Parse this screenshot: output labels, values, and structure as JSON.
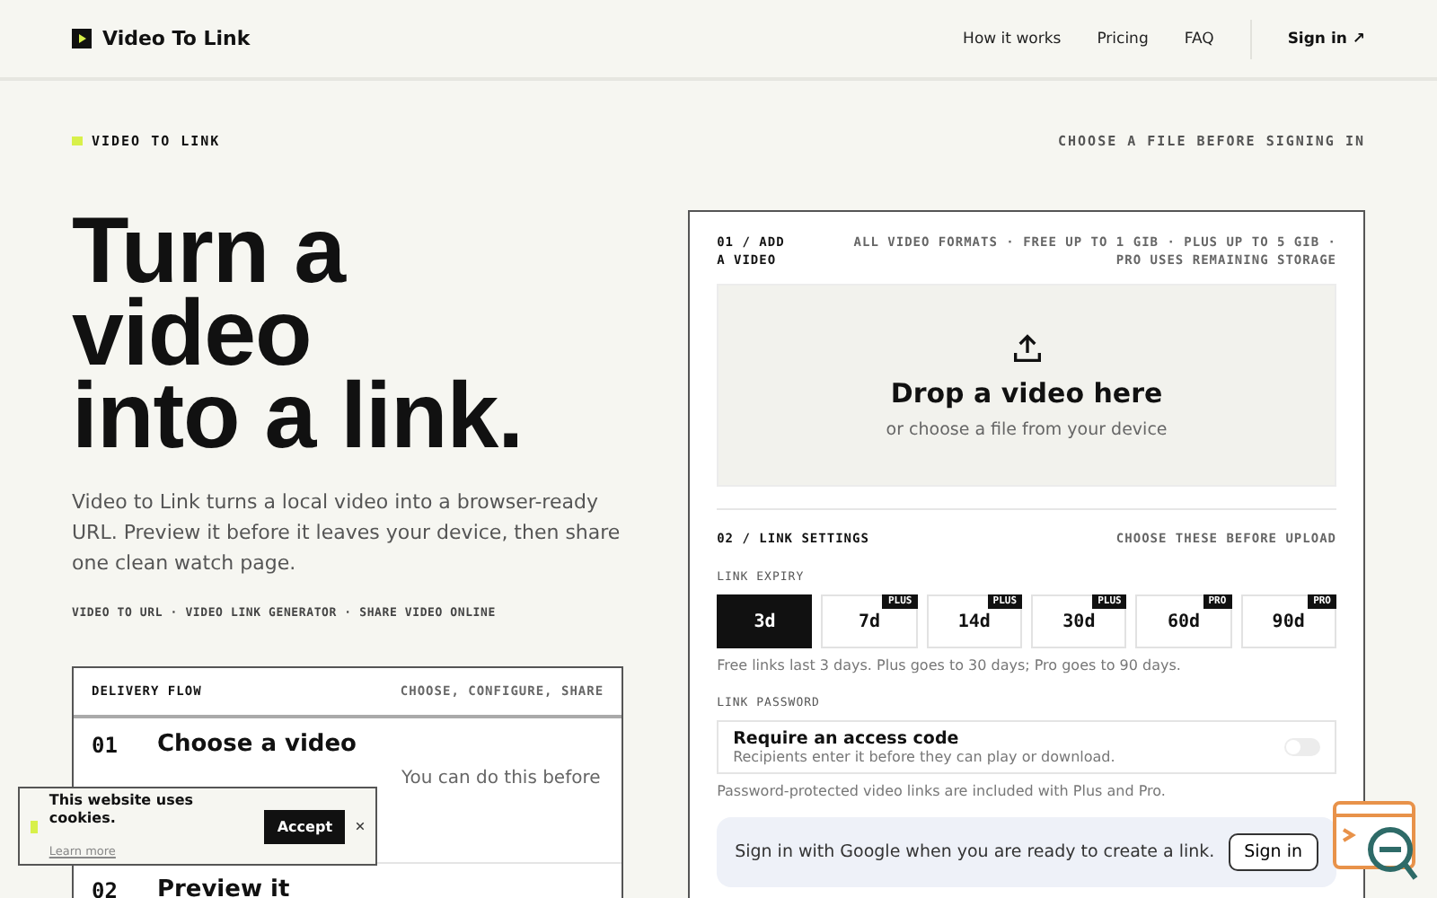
{
  "header": {
    "brand": "Video To Link",
    "nav": [
      "How it works",
      "Pricing",
      "FAQ"
    ],
    "sign_in": "Sign in ↗"
  },
  "eyebrow": {
    "label": "VIDEO TO LINK",
    "note": "CHOOSE A FILE BEFORE SIGNING IN"
  },
  "hero": {
    "headline_lines": [
      "Turn a",
      "video",
      "into a link."
    ],
    "intro": "Video to Link turns a local video into a browser-ready URL. Preview it before it leaves your device, then share one clean watch page.",
    "keywords": "VIDEO TO URL · VIDEO LINK GENERATOR · SHARE VIDEO ONLINE"
  },
  "flow": {
    "title": "DELIVERY FLOW",
    "subtitle": "CHOOSE, CONFIGURE, SHARE",
    "steps": [
      {
        "number": "01",
        "title": "Choose a video",
        "description": "You can do this before"
      },
      {
        "number": "02",
        "title": "Preview it"
      }
    ]
  },
  "upload": {
    "step": "01 / ADD A VIDEO",
    "limits": "ALL VIDEO FORMATS · FREE UP TO 1 GIB · PLUS UP TO 5 GIB · PRO USES REMAINING STORAGE",
    "drop_title": "Drop a video here",
    "drop_hint": "or choose a file from your device"
  },
  "settings": {
    "step": "02 / LINK SETTINGS",
    "note": "CHOOSE THESE BEFORE UPLOAD",
    "expiry_label": "LINK EXPIRY",
    "expiry_options": [
      {
        "label": "3d",
        "selected": true
      },
      {
        "label": "7d",
        "selected": false,
        "tier": "PLUS"
      },
      {
        "label": "14d",
        "selected": false,
        "tier": "PLUS"
      },
      {
        "label": "30d",
        "selected": false,
        "tier": "PLUS"
      },
      {
        "label": "60d",
        "selected": false,
        "tier": "PRO"
      },
      {
        "label": "90d",
        "selected": false,
        "tier": "PRO"
      }
    ],
    "expiry_help": "Free links last 3 days. Plus goes to 30 days; Pro goes to 90 days.",
    "password_label": "LINK PASSWORD",
    "password_title": "Require an access code",
    "password_hint": "Recipients enter it before they can play or download.",
    "password_on": false,
    "password_help": "Password-protected video links are included with Plus and Pro."
  },
  "signin_banner": {
    "text": "Sign in with Google when you are ready to create a link.",
    "button": "Sign in"
  },
  "cookie": {
    "text": "This website uses cookies.",
    "link": "Learn more",
    "accept": "Accept"
  }
}
